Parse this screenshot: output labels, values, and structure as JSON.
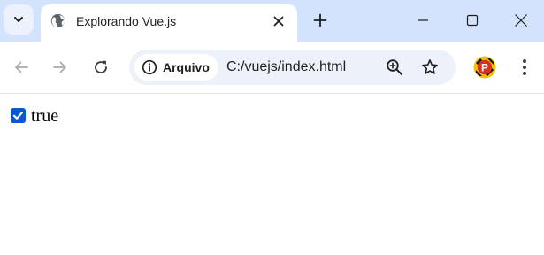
{
  "browser": {
    "tab": {
      "title": "Explorando Vue.js"
    },
    "omnibox": {
      "site_chip_label": "Arquivo",
      "url": "C:/vuejs/index.html"
    },
    "profile": {
      "initial": "P"
    },
    "icons": {
      "tab_search": "chevron-down-icon",
      "favicon": "globe-icon",
      "tab_close": "close-icon",
      "new_tab": "plus-icon",
      "minimize": "minimize-icon",
      "maximize": "maximize-icon",
      "window_close": "close-icon",
      "back": "arrow-left-icon",
      "forward": "arrow-right-icon",
      "reload": "reload-icon",
      "info": "info-icon",
      "zoom": "zoom-in-icon",
      "bookmark": "star-icon",
      "menu": "kebab-menu-icon"
    },
    "colors": {
      "tabstrip": "#d3e3fd",
      "omnibox": "#edf2fa",
      "accent": "#0b57d0"
    }
  },
  "page": {
    "checkbox": {
      "checked": true,
      "value_text": "true"
    }
  }
}
